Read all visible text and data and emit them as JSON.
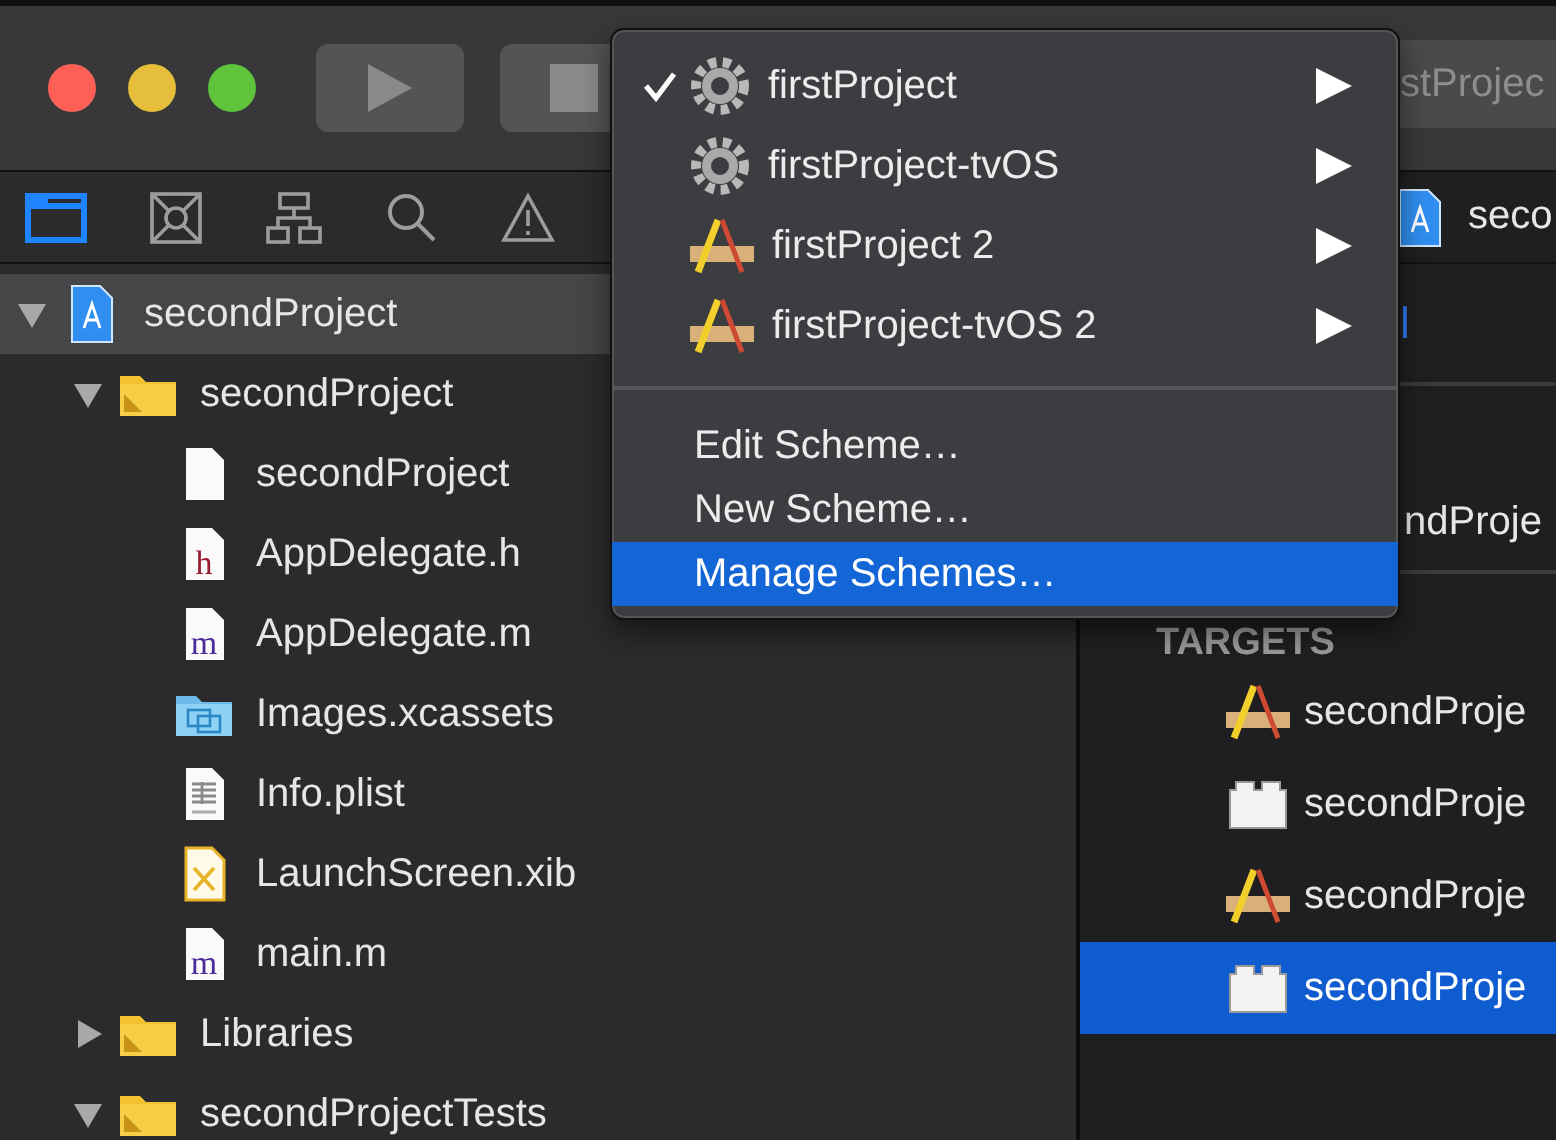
{
  "toolbar": {
    "scheme_field": "stProjec"
  },
  "navigator_tabs": [
    {
      "kind": "files",
      "selected": true
    },
    {
      "kind": "symbols",
      "selected": false
    },
    {
      "kind": "hierarchy",
      "selected": false
    },
    {
      "kind": "search",
      "selected": false
    },
    {
      "kind": "issues",
      "selected": false
    }
  ],
  "tree": [
    {
      "name": "secondProject",
      "kind": "project",
      "expanded": true,
      "selected": true,
      "children": [
        {
          "name": "secondProject",
          "kind": "folder",
          "expanded": true,
          "selected": false,
          "children": [
            {
              "name": "secondProject",
              "kind": "file",
              "selected": false
            },
            {
              "name": "AppDelegate.h",
              "kind": "header",
              "icon_letter": "h",
              "selected": false
            },
            {
              "name": "AppDelegate.m",
              "kind": "source",
              "icon_letter": "m",
              "selected": false
            },
            {
              "name": "Images.xcassets",
              "kind": "assets",
              "selected": false
            },
            {
              "name": "Info.plist",
              "kind": "plist",
              "selected": false
            },
            {
              "name": "LaunchScreen.xib",
              "kind": "xib",
              "selected": false
            },
            {
              "name": "main.m",
              "kind": "source",
              "icon_letter": "m",
              "selected": false
            }
          ]
        },
        {
          "name": "Libraries",
          "kind": "folder",
          "expanded": false,
          "selected": false
        },
        {
          "name": "secondProjectTests",
          "kind": "folder",
          "expanded": true,
          "selected": false
        }
      ]
    }
  ],
  "editor": {
    "jump_bar_title": "seco",
    "tab_fragment": "l",
    "project_fragment": "ndProje",
    "targets_heading": "TARGETS",
    "targets": [
      {
        "name": "secondProje",
        "kind": "app",
        "selected": false
      },
      {
        "name": "secondProje",
        "kind": "bundle",
        "selected": false
      },
      {
        "name": "secondProje",
        "kind": "app",
        "selected": false
      },
      {
        "name": "secondProje",
        "kind": "bundle",
        "selected": true
      }
    ]
  },
  "scheme_menu": {
    "schemes": [
      {
        "name": "firstProject",
        "kind": "gear",
        "checked": true
      },
      {
        "name": "firstProject-tvOS",
        "kind": "gear",
        "checked": false
      },
      {
        "name": "firstProject 2",
        "kind": "app",
        "checked": false
      },
      {
        "name": "firstProject-tvOS 2",
        "kind": "app",
        "checked": false
      }
    ],
    "actions": [
      {
        "label": "Edit Scheme…",
        "selected": false
      },
      {
        "label": "New Scheme…",
        "selected": false
      },
      {
        "label": "Manage Schemes…",
        "selected": true
      }
    ]
  }
}
